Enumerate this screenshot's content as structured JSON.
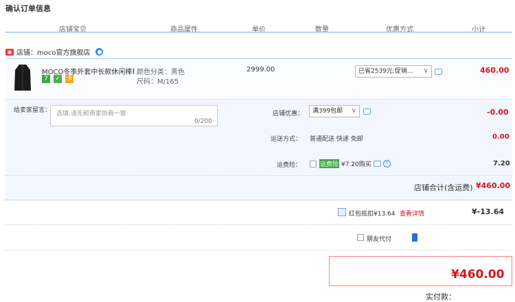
{
  "page": {
    "title": "确认订单信息"
  },
  "columns": [
    "店铺宝贝",
    "商品属性",
    "单价",
    "数量",
    "优惠方式",
    "小计"
  ],
  "shop": {
    "label": "店铺：moco官方旗舰店"
  },
  "item": {
    "name": "MOCO冬季外套中长款休闲棒球...",
    "badges": [
      "7",
      "✓",
      "卡"
    ],
    "attr_color": "颜色分类：黑色",
    "attr_size": "尺码：M/165",
    "price": "2999.00",
    "discount_select": "已省2539元:促销...",
    "subtotal": "460.00"
  },
  "summary": {
    "message_label": "给卖家留言：",
    "message_placeholder": "选填,请先和商家协商一致",
    "message_count": "0/200",
    "shop_discount_label": "店铺优惠：",
    "shop_discount_select": "满399包邮",
    "shop_discount_value": "-0.00",
    "shipping_label": "运送方式：",
    "shipping_value": "普通配送 快递 免邮",
    "shipping_fee": "0.00",
    "insurance_label": "运费险：",
    "insurance_tag": "运费险",
    "insurance_text": "¥7.20购买",
    "insurance_value": "7.20",
    "shop_total_label": "店铺合计(含运费)",
    "shop_total_value": "¥460.00"
  },
  "redpacket": {
    "label": "红包抵扣¥13.64",
    "link": "查看详情",
    "value": "¥-13.64"
  },
  "friend_pay": {
    "label": "朋友代付"
  },
  "total": {
    "label": "实付款：",
    "value": "¥460.00"
  },
  "colors": {
    "accent": "#d4141d",
    "header_line": "#b2d1ff",
    "summary_bg": "#f2f7ff"
  }
}
